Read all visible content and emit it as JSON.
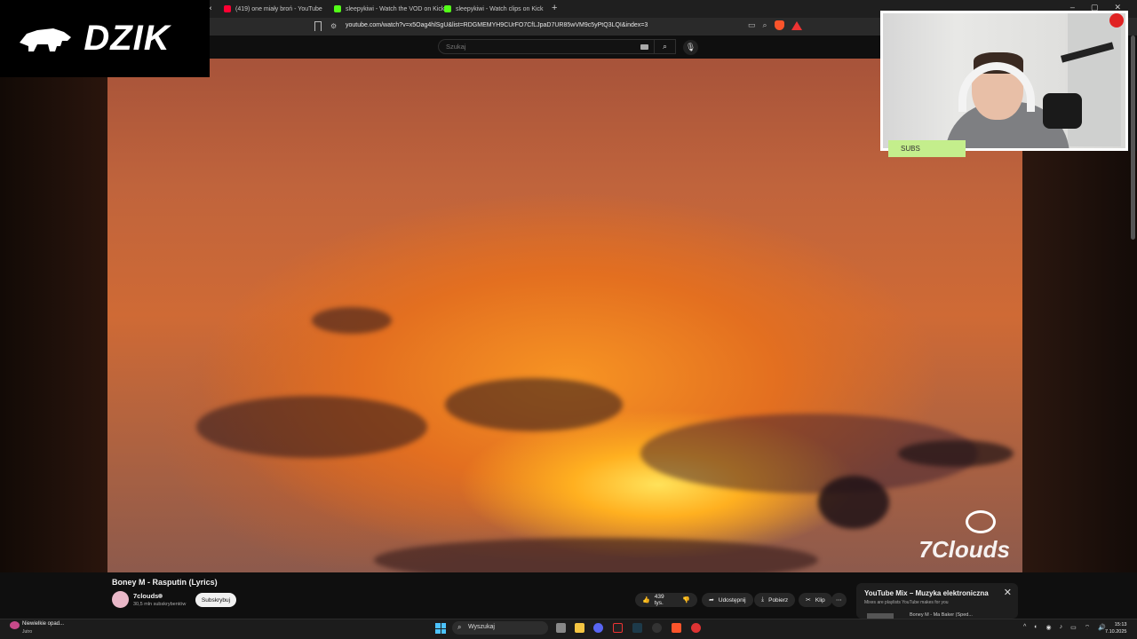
{
  "browser": {
    "tabs": [
      {
        "label": "(419) one miały broń - YouTube",
        "favicon": "youtube-icon"
      },
      {
        "label": "sleepykiwi - Watch the VOD on Kick",
        "favicon": "kick-icon"
      },
      {
        "label": "sleepykiwi - Watch clips on Kick",
        "favicon": "kick-icon"
      }
    ],
    "new_tab": "+",
    "tab_close": "×",
    "url": "youtube.com/watch?v=x5Oag4hlSgU&list=RDGMEMYH9CUrFO7CfLJpaD7UR85wVM9c5yPtQ3LQI&index=3",
    "window_controls": [
      "–",
      "▢",
      "✕"
    ]
  },
  "youtube": {
    "search_placeholder": "Szukaj",
    "search_icon": "⌕",
    "mic_icon": "🎙",
    "video": {
      "title": "Boney M - Rasputin (Lyrics)",
      "channel": "7clouds",
      "subscribers": "30,5 mln subskrybentów",
      "subscribe_label": "Subskrybuj",
      "watermark": "7Clouds",
      "likes": "439 tys.",
      "share_label": "Udostępnij",
      "download_label": "Pobierz",
      "clip_label": "Klip",
      "more_label": "⋯"
    },
    "mix": {
      "title": "YouTube Mix – Muzyka elektroniczna",
      "subtitle": "Mixes are playlists YouTube makes for you",
      "close": "✕",
      "first_item": "Boney M - Ma Baker (Sped..."
    }
  },
  "overlay": {
    "logo_text": "DZIK",
    "subs_label": "SUBS"
  },
  "taskbar": {
    "weather_text": "Niewielkie opad...",
    "weather_sub": "Jutro",
    "search_label": "Wyszukaj",
    "time": "15:13",
    "date": "7.10.2025"
  }
}
